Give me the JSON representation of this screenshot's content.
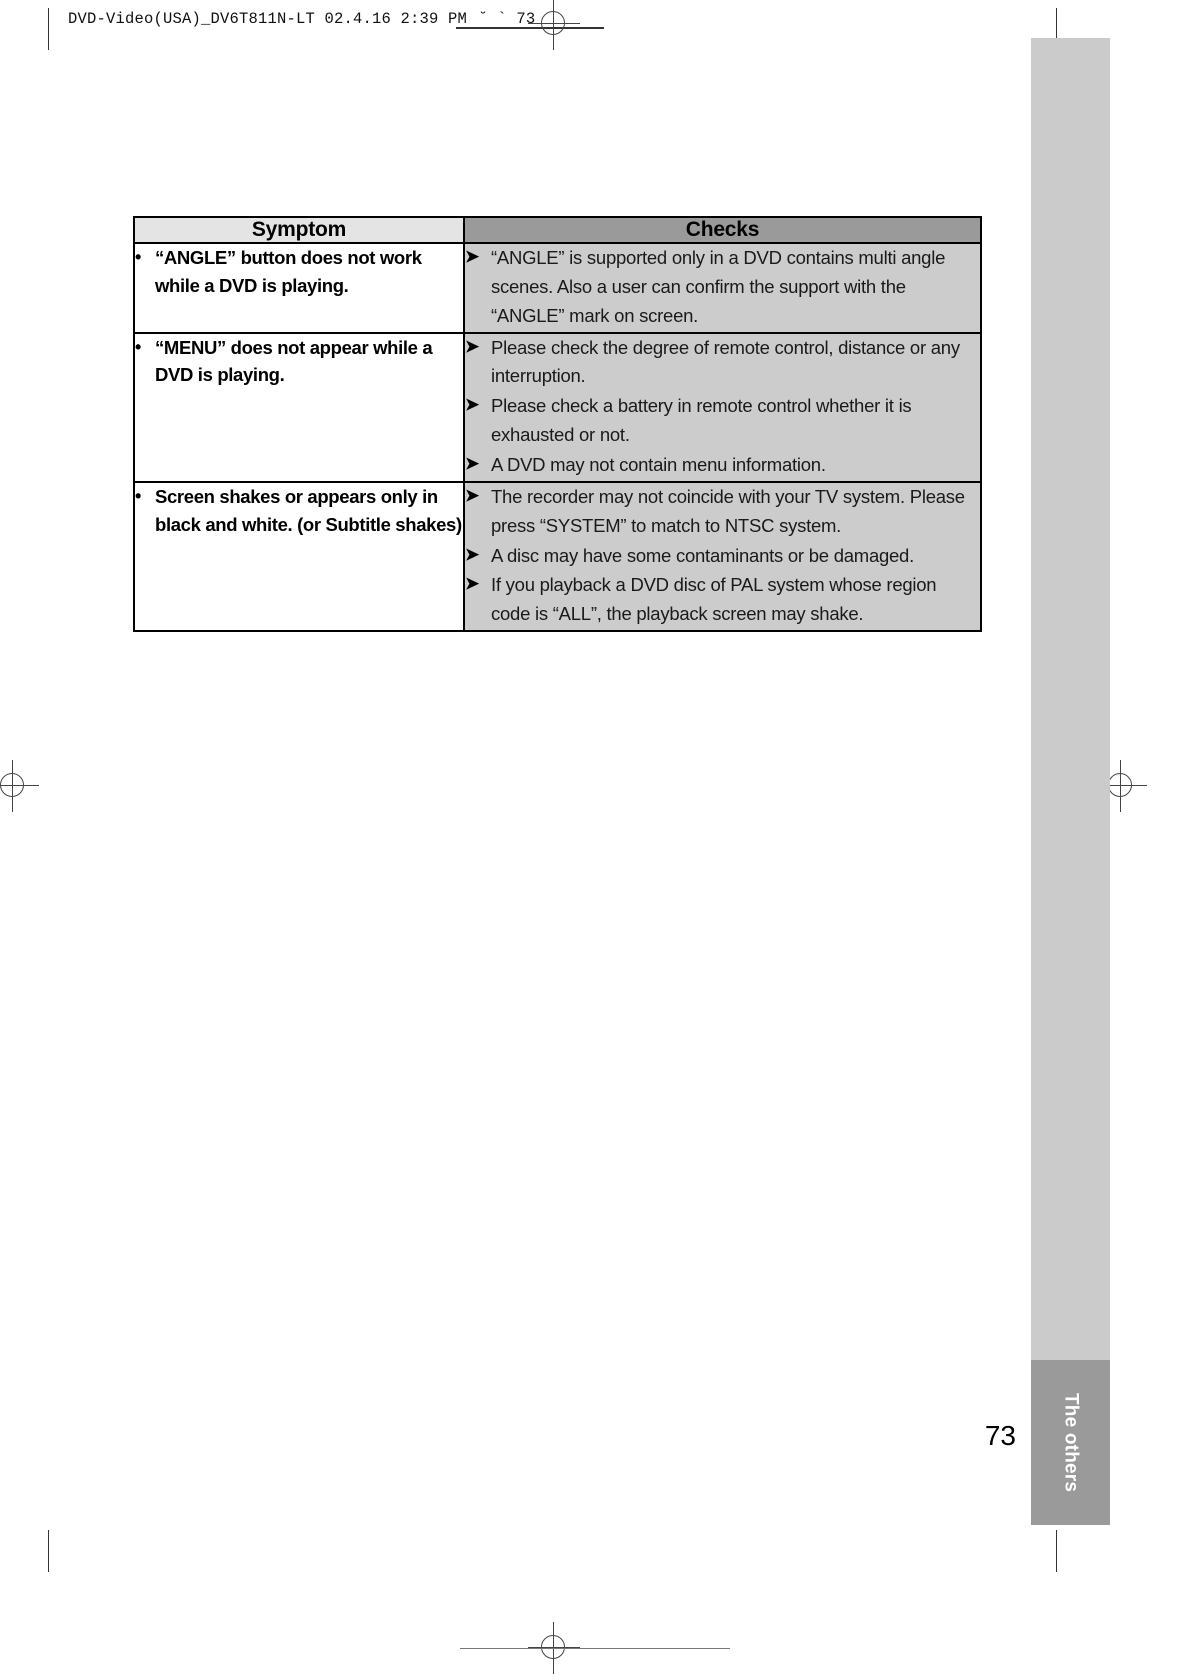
{
  "slug": {
    "text": "DVD-Video(USA)_DV6T811N-LT  02.4.16 2:39 PM",
    "suffix": "˘  `  73"
  },
  "edge_tab": {
    "label": "The others"
  },
  "page_number": "73",
  "table": {
    "headers": {
      "symptom": "Symptom",
      "checks": "Checks"
    },
    "bullet_glyph": "•",
    "arrow_glyph": "➤",
    "rows": [
      {
        "symptom": "“ANGLE” button does not work while a DVD is playing.",
        "checks": [
          "“ANGLE” is supported only in a DVD contains multi angle scenes. Also a user can confirm the support with the  “ANGLE” mark on screen."
        ]
      },
      {
        "symptom": "“MENU” does not appear while a DVD is playing.",
        "checks": [
          "Please check the degree of remote control, distance or any interruption.",
          "Please check a battery in remote control whether it is exhausted or not.",
          "A DVD may not contain menu information."
        ]
      },
      {
        "symptom": "Screen shakes or appears only in black and white. (or Subtitle shakes)",
        "checks": [
          "The recorder may not coincide with your TV system. Please press “SYSTEM” to match to NTSC system.",
          "A disc may have some contaminants or be damaged.",
          "If you playback a DVD disc of PAL system whose region code is “ALL”, the playback screen may shake."
        ]
      }
    ]
  },
  "colors": {
    "header_symptom_bg": "#e4e4e4",
    "header_checks_bg": "#9a9a9a",
    "checks_cell_bg": "#cccccc",
    "edge_band_light": "#cbcbcb",
    "edge_band_dark": "#9a9a9a"
  }
}
